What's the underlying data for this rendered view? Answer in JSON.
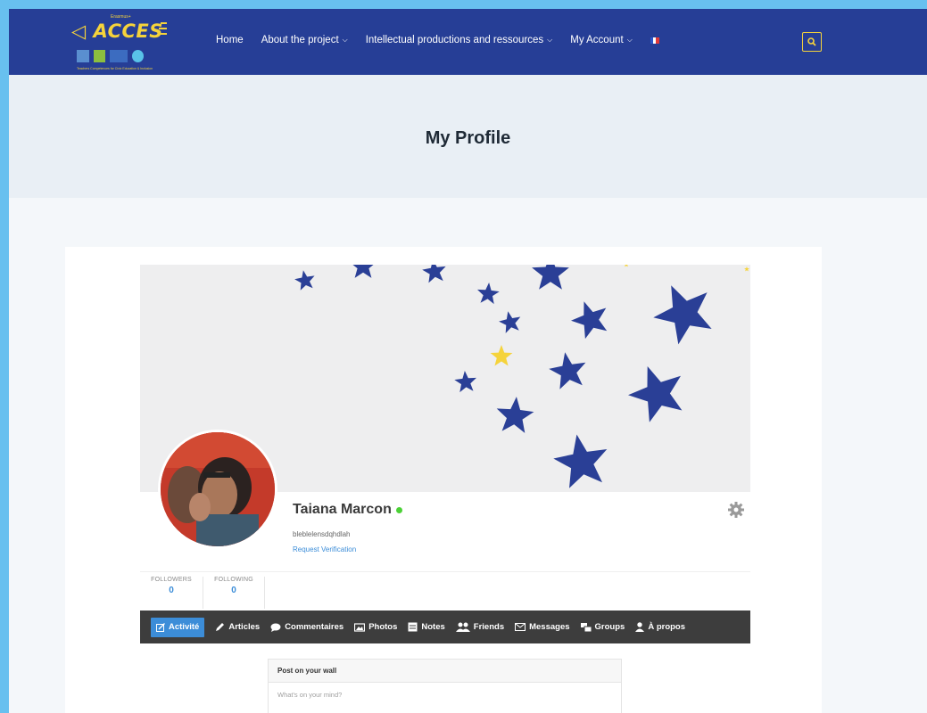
{
  "brand": {
    "small_text": "Erasmus+",
    "name": "ACCES",
    "tagline": "Teachers Competences for Civic Education & Inclusion"
  },
  "nav": {
    "items": [
      {
        "label": "Home",
        "has_menu": false
      },
      {
        "label": "About the project",
        "has_menu": true
      },
      {
        "label": "Intellectual productions and ressources",
        "has_menu": true
      },
      {
        "label": "My Account",
        "has_menu": true
      }
    ],
    "language_flag": "fr-flag-icon",
    "search_icon": "search-icon"
  },
  "page": {
    "title": "My Profile"
  },
  "profile": {
    "name": "Taiana Marcon",
    "status": "online",
    "username": "bleblelensdqhdlah",
    "verify_link": "Request Verification",
    "settings_icon": "gear-icon"
  },
  "stats": {
    "followers_label": "FOLLOWERS",
    "followers_count": "0",
    "following_label": "FOLLOWING",
    "following_count": "0"
  },
  "tabs": [
    {
      "label": "Activité",
      "icon": "edit-icon",
      "active": true
    },
    {
      "label": "Articles",
      "icon": "pencil-icon",
      "active": false
    },
    {
      "label": "Commentaires",
      "icon": "comment-icon",
      "active": false
    },
    {
      "label": "Photos",
      "icon": "photo-icon",
      "active": false
    },
    {
      "label": "Notes",
      "icon": "note-icon",
      "active": false
    },
    {
      "label": "Friends",
      "icon": "friends-icon",
      "active": false
    },
    {
      "label": "Messages",
      "icon": "envelope-icon",
      "active": false
    },
    {
      "label": "Groups",
      "icon": "groups-icon",
      "active": false
    },
    {
      "label": "À propos",
      "icon": "user-icon",
      "active": false
    }
  ],
  "wall": {
    "heading": "Post on your wall",
    "placeholder": "What's on your mind?"
  },
  "colors": {
    "header_bg": "#263e96",
    "brand_yellow": "#f5d33b",
    "link_blue": "#3c8dd8",
    "tabbar_bg": "#3d3d3d",
    "online_green": "#4cd137",
    "star_blue": "#2a3f96"
  }
}
